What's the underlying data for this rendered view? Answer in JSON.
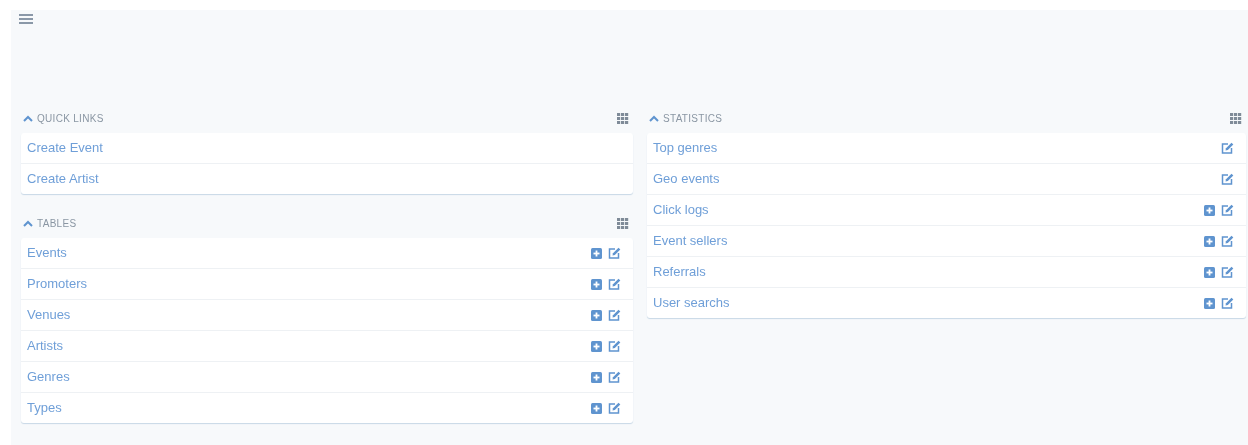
{
  "columns": [
    {
      "sections": [
        {
          "title": "QUICK LINKS",
          "expanded": true,
          "items": [
            {
              "label": "Create Event",
              "add": false,
              "edit": false
            },
            {
              "label": "Create Artist",
              "add": false,
              "edit": false
            }
          ]
        },
        {
          "title": "TABLES",
          "expanded": true,
          "items": [
            {
              "label": "Events",
              "add": true,
              "edit": true
            },
            {
              "label": "Promoters",
              "add": true,
              "edit": true
            },
            {
              "label": "Venues",
              "add": true,
              "edit": true
            },
            {
              "label": "Artists",
              "add": true,
              "edit": true
            },
            {
              "label": "Genres",
              "add": true,
              "edit": true
            },
            {
              "label": "Types",
              "add": true,
              "edit": true
            }
          ]
        }
      ]
    },
    {
      "sections": [
        {
          "title": "STATISTICS",
          "expanded": true,
          "items": [
            {
              "label": "Top genres",
              "add": false,
              "edit": true
            },
            {
              "label": "Geo events",
              "add": false,
              "edit": true
            },
            {
              "label": "Click logs",
              "add": true,
              "edit": true
            },
            {
              "label": "Event sellers",
              "add": true,
              "edit": true
            },
            {
              "label": "Referrals",
              "add": true,
              "edit": true
            },
            {
              "label": "User searchs",
              "add": true,
              "edit": true
            }
          ]
        }
      ]
    }
  ]
}
